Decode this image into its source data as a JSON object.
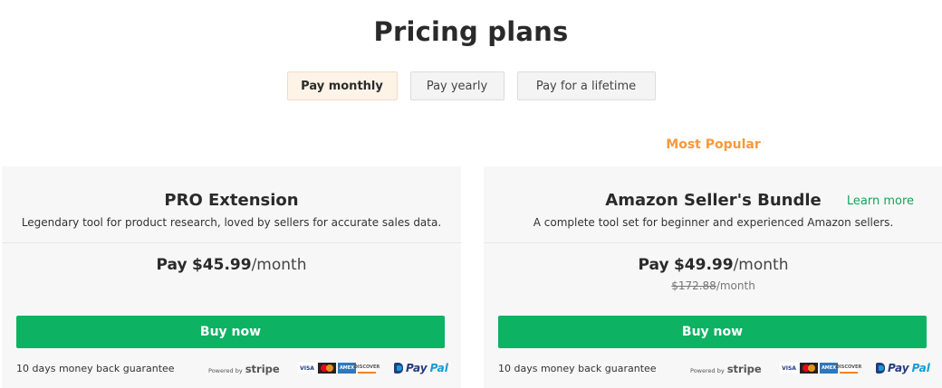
{
  "page": {
    "title": "Pricing plans"
  },
  "tabs": [
    {
      "label": "Pay monthly",
      "active": true
    },
    {
      "label": "Pay yearly",
      "active": false
    },
    {
      "label": "Pay for a lifetime",
      "active": false
    }
  ],
  "badge": {
    "most_popular": "Most Popular"
  },
  "plans": [
    {
      "name": "PRO Extension",
      "description": "Legendary tool for product research, loved by sellers for accurate sales data.",
      "price_prefix": "Pay",
      "price": "$45.99",
      "per": "/month",
      "buy_label": "Buy now",
      "guarantee": "10 days money back guarantee"
    },
    {
      "name": "Amazon Seller's Bundle",
      "learn_more": "Learn more",
      "description": "A complete tool set for beginner and experienced Amazon sellers.",
      "price_prefix": "Pay",
      "price": "$49.99",
      "per": "/month",
      "old_price": "$172.88",
      "old_per": "/month",
      "buy_label": "Buy now",
      "guarantee": "10 days money back guarantee"
    }
  ],
  "payment": {
    "powered_by": "Powered by",
    "stripe": "stripe",
    "visa": "VISA",
    "amex": "AMEX",
    "discover": "DISCOVER",
    "paypal_pay": "Pay",
    "paypal_pal": "Pal"
  },
  "colors": {
    "accent_green": "#0db263",
    "popular_orange": "#f59a3c",
    "active_tab_bg": "#fdf3e7"
  }
}
